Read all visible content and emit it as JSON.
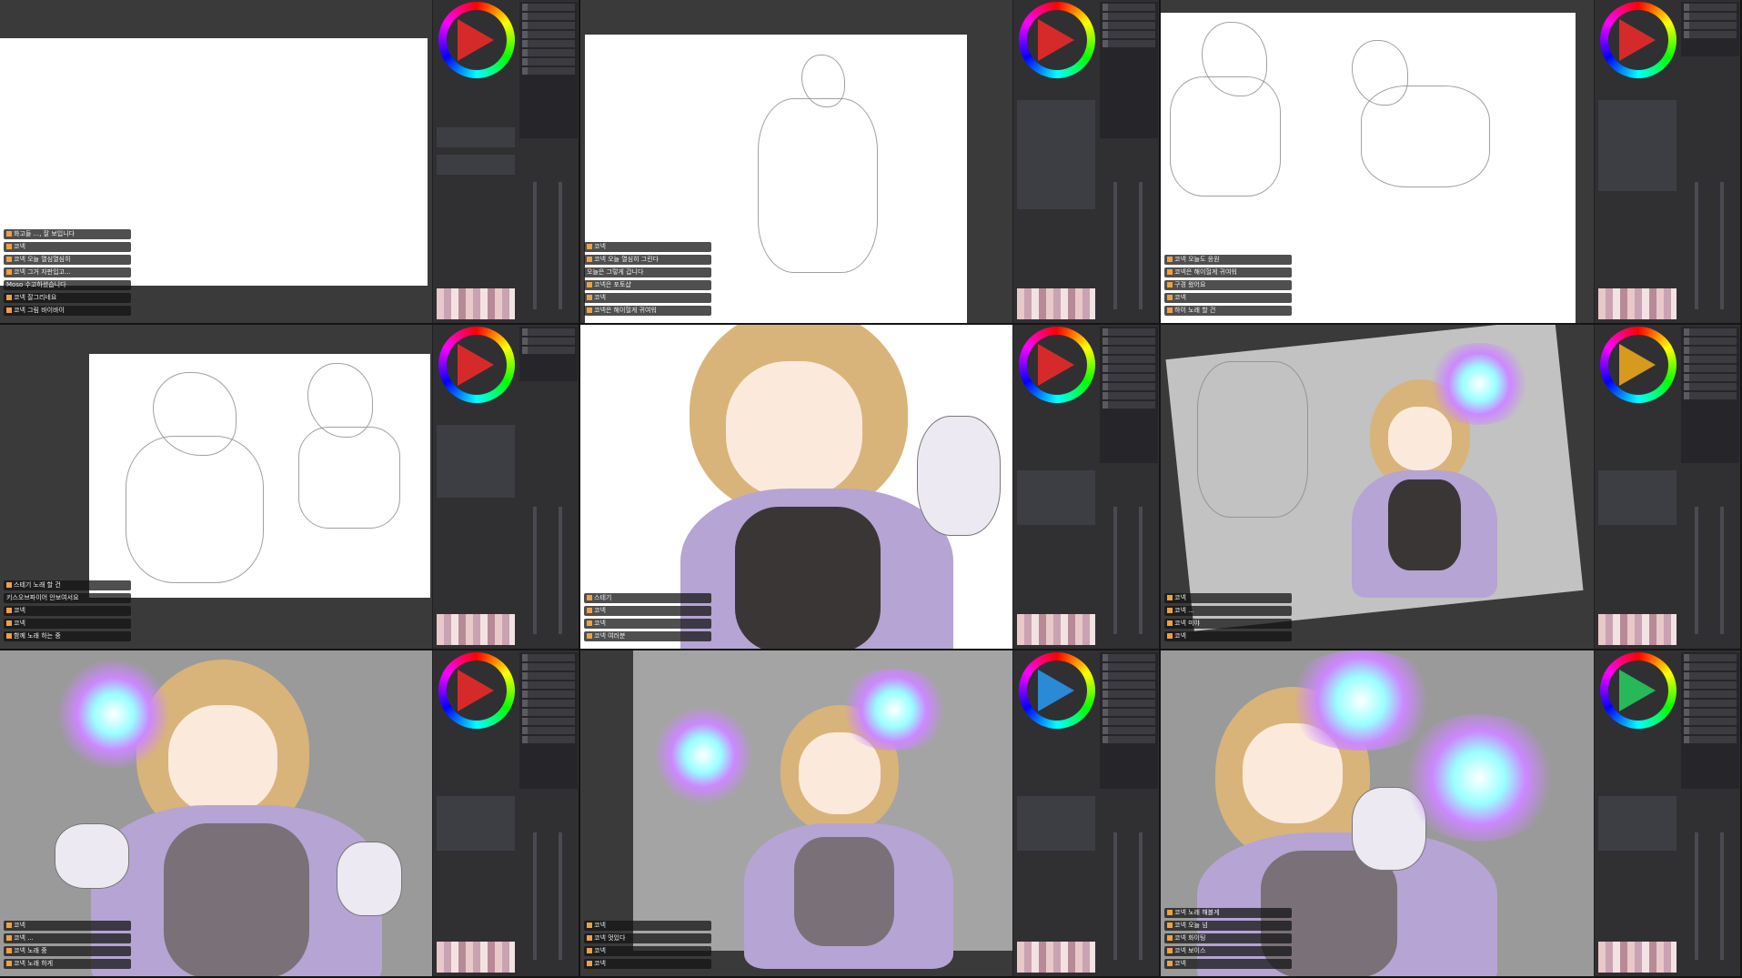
{
  "tiles": [
    {
      "stage": "blank",
      "chat": [
        "화고들 ..., 잘 보입니다",
        "코넥",
        "코넥 오늘 열심열심히",
        "코넥 그거 자판입고...",
        "Moso 수고하셨습니다",
        "코넥 잘그리네요",
        "코넥 그림 바이바이"
      ]
    },
    {
      "stage": "sketch",
      "chat": [
        "코넥",
        "코넥 오늘 열심히 그린다",
        "오늘은 그렇게 갑니다",
        "코넥은 포토샵",
        "코넥",
        "코넥은 해이헐게 귀여워"
      ]
    },
    {
      "stage": "sketch2",
      "chat": [
        "코넥 오늘도 응원",
        "코넥은 해이헐게 귀여워",
        "구경 왔어요",
        "코넥",
        "하이 노래 할 건"
      ]
    },
    {
      "stage": "lineart",
      "chat": [
        "스테기 노래 할 건",
        "키스오브파이어 안보여서요",
        "코넥",
        "코넥",
        "함께 노래 하는 중"
      ]
    },
    {
      "stage": "flat",
      "chat": [
        "스테기",
        "코넥",
        "코넥",
        "코넥 여러분"
      ]
    },
    {
      "stage": "color",
      "chat": [
        "코넥",
        "코넥 ...",
        "코넥 미야",
        "코넥"
      ]
    },
    {
      "stage": "render",
      "chat": [
        "코넥",
        "코넥 ...",
        "코넥 노래 중",
        "코넥 노래 하게"
      ]
    },
    {
      "stage": "effects",
      "chat": [
        "코넥",
        "코넥 멋있다",
        "코넥",
        "코넥"
      ]
    },
    {
      "stage": "final",
      "chat": [
        "코넥 노래 해볼게",
        "코넥 오늘 넘",
        "코넥 화이팅",
        "코넥 보이스",
        "코넥"
      ]
    }
  ],
  "colors": {
    "wheel_triangle": [
      "#d62a2a",
      "#d62a2a",
      "#d62a2a",
      "#d62a2a",
      "#d62a2a",
      "#d69a1e",
      "#d62a2a",
      "#2a8ad6",
      "#27b85a"
    ]
  }
}
